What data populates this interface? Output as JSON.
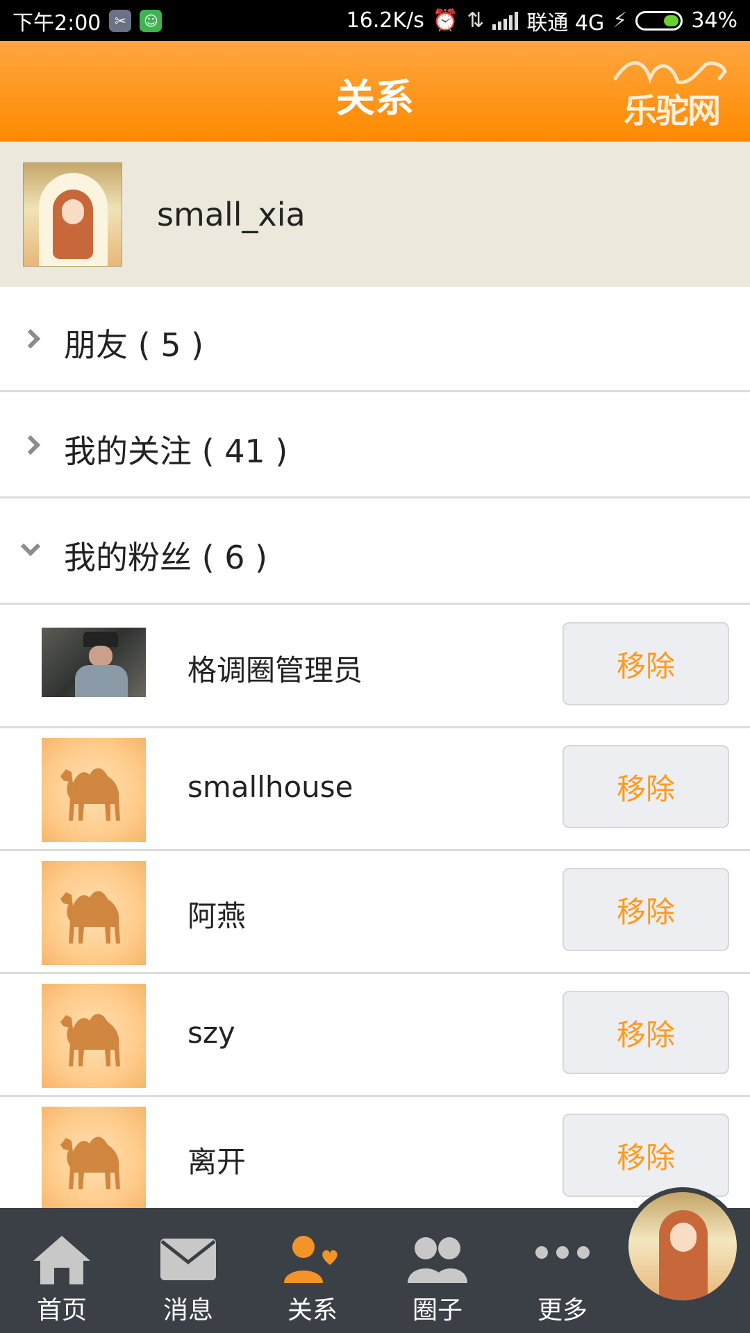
{
  "status_bar": {
    "time": "下午2:00",
    "speed": "16.2K/s",
    "carrier": "联通 4G",
    "battery": "34%",
    "battery_level": 0.34
  },
  "header": {
    "title": "关系",
    "brand": "乐驼网"
  },
  "profile": {
    "username": "small_xia"
  },
  "groups": [
    {
      "label": "朋友 ( 5 )",
      "expanded": false
    },
    {
      "label": "我的关注 ( 41 )",
      "expanded": false
    },
    {
      "label": "我的粉丝 ( 6 )",
      "expanded": true
    }
  ],
  "fans": [
    {
      "name": "格调圈管理员",
      "avatar": "photo",
      "action": "移除"
    },
    {
      "name": "smallhouse",
      "avatar": "camel-icon",
      "action": "移除"
    },
    {
      "name": "阿燕",
      "avatar": "camel-icon",
      "action": "移除"
    },
    {
      "name": "szy",
      "avatar": "camel-icon",
      "action": "移除"
    },
    {
      "name": "离开",
      "avatar": "camel-icon",
      "action": "移除"
    }
  ],
  "bottom_nav": [
    {
      "label": "首页",
      "icon": "home-icon",
      "active": false
    },
    {
      "label": "消息",
      "icon": "mail-icon",
      "active": false
    },
    {
      "label": "关系",
      "icon": "relation-icon",
      "active": true
    },
    {
      "label": "圈子",
      "icon": "group-icon",
      "active": false
    },
    {
      "label": "更多",
      "icon": "more-icon",
      "active": false
    }
  ],
  "colors": {
    "accent": "#ff8a00",
    "remove_text": "#ff9a1a",
    "nav_bg": "#3b3f46",
    "profile_bg": "#ece9dc"
  }
}
